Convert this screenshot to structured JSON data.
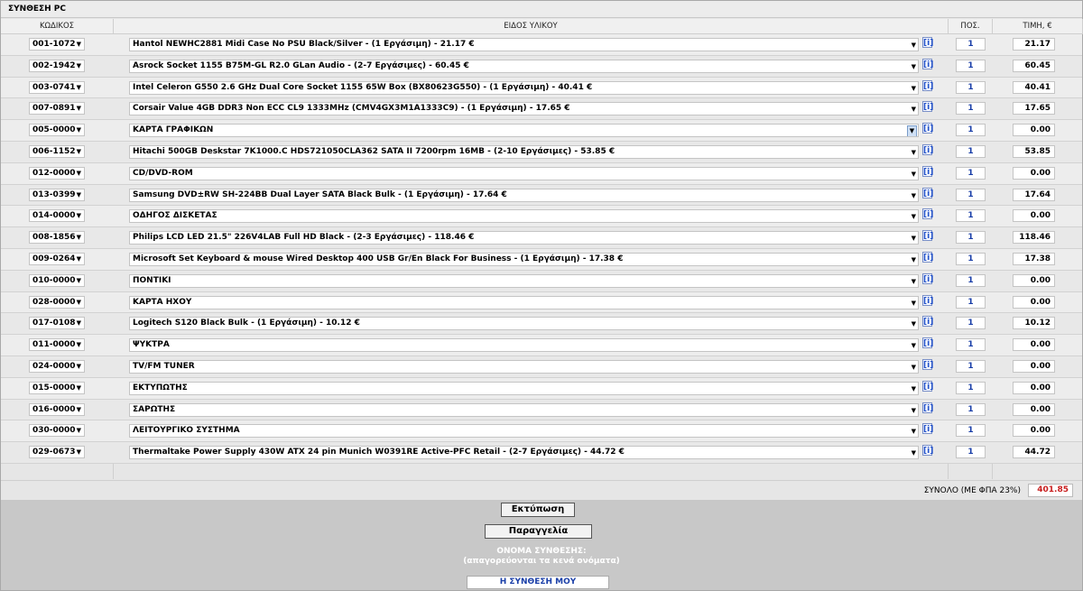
{
  "title": "ΣΥΝΘΕΣΗ PC",
  "headers": {
    "code": "ΚΩΔΙΚΟΣ",
    "item": "ΕΙΔΟΣ ΥΛΙΚΟΥ",
    "qty": "ΠΟΣ.",
    "price": "ΤΙΜΗ, €"
  },
  "info_label": "[i]",
  "rows": [
    {
      "code": "001-1072",
      "item": "Hantol NEWHC2881 Midi Case No PSU Black/Silver - (1 Εργάσιμη) - 21.17 €",
      "qty": "1",
      "price": "21.17"
    },
    {
      "code": "002-1942",
      "item": "Asrock Socket 1155 B75M-GL R2.0 GLan Audio - (2-7 Εργάσιμες) - 60.45 €",
      "qty": "1",
      "price": "60.45"
    },
    {
      "code": "003-0741",
      "item": "Intel Celeron G550 2.6 GHz Dual Core Socket 1155 65W Box (BX80623G550) - (1 Εργάσιμη) - 40.41 €",
      "qty": "1",
      "price": "40.41"
    },
    {
      "code": "007-0891",
      "item": "Corsair Value 4GB DDR3 Non ECC CL9 1333MHz (CMV4GX3M1A1333C9) - (1 Εργάσιμη) - 17.65 €",
      "qty": "1",
      "price": "17.65"
    },
    {
      "code": "005-0000",
      "item": "ΚΑΡΤΑ ΓΡΑΦΙΚΩΝ",
      "qty": "1",
      "price": "0.00",
      "focused": true
    },
    {
      "code": "006-1152",
      "item": "Hitachi 500GB Deskstar 7K1000.C HDS721050CLA362 SATA II 7200rpm 16MB - (2-10 Εργάσιμες) - 53.85 €",
      "qty": "1",
      "price": "53.85"
    },
    {
      "code": "012-0000",
      "item": "CD/DVD-ROM",
      "qty": "1",
      "price": "0.00"
    },
    {
      "code": "013-0399",
      "item": "Samsung DVD±RW SH-224BB Dual Layer SATA Black Bulk - (1 Εργάσιμη) - 17.64 €",
      "qty": "1",
      "price": "17.64"
    },
    {
      "code": "014-0000",
      "item": "ΟΔΗΓΟΣ ΔΙΣΚΕΤΑΣ",
      "qty": "1",
      "price": "0.00"
    },
    {
      "code": "008-1856",
      "item": "Philips LCD LED 21.5\" 226V4LAB Full HD Black - (2-3 Εργάσιμες) - 118.46 €",
      "qty": "1",
      "price": "118.46"
    },
    {
      "code": "009-0264",
      "item": "Microsoft Set Keyboard & mouse Wired Desktop 400 USB Gr/En Black For Business - (1 Εργάσιμη) - 17.38 €",
      "qty": "1",
      "price": "17.38"
    },
    {
      "code": "010-0000",
      "item": "ΠΟΝΤΙΚΙ",
      "qty": "1",
      "price": "0.00"
    },
    {
      "code": "028-0000",
      "item": "ΚΑΡΤΑ ΗΧΟΥ",
      "qty": "1",
      "price": "0.00"
    },
    {
      "code": "017-0108",
      "item": "Logitech S120 Black Bulk - (1 Εργάσιμη) - 10.12 €",
      "qty": "1",
      "price": "10.12"
    },
    {
      "code": "011-0000",
      "item": "ΨΥΚΤΡΑ",
      "qty": "1",
      "price": "0.00"
    },
    {
      "code": "024-0000",
      "item": "TV/FM TUNER",
      "qty": "1",
      "price": "0.00"
    },
    {
      "code": "015-0000",
      "item": "ΕΚΤΥΠΩΤΗΣ",
      "qty": "1",
      "price": "0.00"
    },
    {
      "code": "016-0000",
      "item": "ΣΑΡΩΤΗΣ",
      "qty": "1",
      "price": "0.00"
    },
    {
      "code": "030-0000",
      "item": "ΛΕΙΤΟΥΡΓΙΚΟ ΣΥΣΤΗΜΑ",
      "qty": "1",
      "price": "0.00"
    },
    {
      "code": "029-0673",
      "item": "Thermaltake Power Supply 430W ATX 24 pin Munich W0391RE Active-PFC Retail - (2-7 Εργάσιμες) - 44.72 €",
      "qty": "1",
      "price": "44.72"
    }
  ],
  "total": {
    "label": "ΣΥΝΟΛΟ (ΜΕ ΦΠΑ 23%)",
    "value": "401.85"
  },
  "buttons": {
    "print": "Εκτύπωση",
    "order": "Παραγγελία"
  },
  "name_section": {
    "label": "ΟΝΟΜΑ ΣΥΝΘΕΣΗΣ:",
    "note": "(απαγορεύονται τα κενά ονόματα)",
    "value": "Η ΣΥΝΘΕΣΗ ΜΟΥ"
  },
  "colors": {
    "total": "#c81e1e",
    "qty": "#1a3fa8",
    "info": "#2050c8"
  }
}
